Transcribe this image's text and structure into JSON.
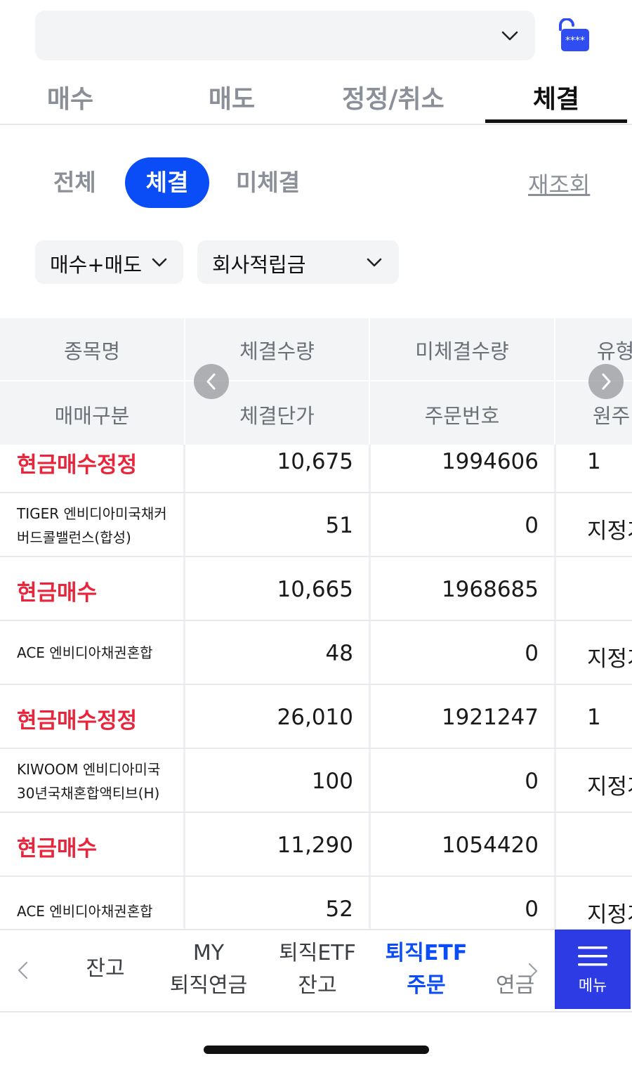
{
  "account": {
    "value": ""
  },
  "main_tabs": [
    "매수",
    "매도",
    "정정/취소",
    "체결"
  ],
  "filters": {
    "all": "전체",
    "filled": "체결",
    "unfilled": "미체결",
    "refresh": "재조회"
  },
  "dropdowns": {
    "side": "매수+매도",
    "account_type": "회사적립금"
  },
  "table": {
    "headers_top": [
      "종목명",
      "체결수량",
      "미체결수량",
      "유형"
    ],
    "headers_bottom": [
      "매매구분",
      "체결단가",
      "주문번호",
      "원주"
    ],
    "rows": [
      {
        "c1": "현금매수정정",
        "c1_style": "red",
        "c2": "10,675",
        "c3": "1994606",
        "c4": "1"
      },
      {
        "c1a": "TIGER 엔비디아미국채커",
        "c1b": "버드콜밸런스(합성)",
        "c1_style": "name",
        "c2": "51",
        "c3": "0",
        "c4": "지정가"
      },
      {
        "c1": "현금매수",
        "c1_style": "red",
        "c2": "10,665",
        "c3": "1968685",
        "c4": ""
      },
      {
        "c1": "ACE 엔비디아채권혼합",
        "c1_style": "name",
        "c2": "48",
        "c3": "0",
        "c4": "지정가"
      },
      {
        "c1": "현금매수정정",
        "c1_style": "red",
        "c2": "26,010",
        "c3": "1921247",
        "c4": "1"
      },
      {
        "c1a": "KIWOOM 엔비디아미국",
        "c1b": "30년국채혼합액티브(H)",
        "c1_style": "name",
        "c2": "100",
        "c3": "0",
        "c4": "지정가"
      },
      {
        "c1": "현금매수",
        "c1_style": "red",
        "c2": "11,290",
        "c3": "1054420",
        "c4": ""
      },
      {
        "c1": "ACE 엔비디아채권혼합",
        "c1_style": "name",
        "c2": "52",
        "c3": "0",
        "c4": "지정가"
      }
    ]
  },
  "bottom_nav": {
    "item1": "잔고",
    "item2a": "MY",
    "item2b": "퇴직연금",
    "item3a": "퇴직ETF",
    "item3b": "잔고",
    "item4a": "퇴직ETF",
    "item4b": "주문",
    "item5": "연금",
    "menu": "메뉴"
  },
  "colors": {
    "accent": "#0a4cf6",
    "sell_buy_red": "#e8253a",
    "menu_bg": "#2d3be4"
  }
}
